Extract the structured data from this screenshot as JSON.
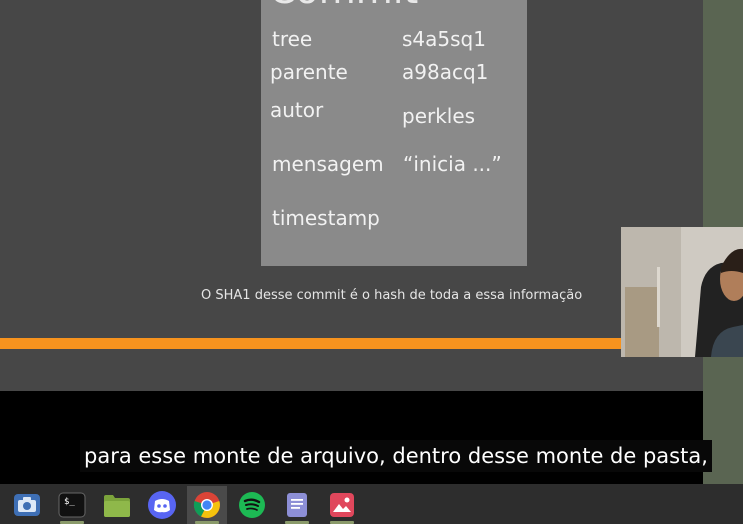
{
  "slide": {
    "commit_title": "Commit",
    "fields": [
      {
        "key": "tree",
        "value": "s4a5sq1"
      },
      {
        "key": "parente",
        "value": "a98acq1"
      },
      {
        "key": "autor",
        "value": "perkles"
      },
      {
        "key": "mensagem",
        "value": "“inicia ...”"
      },
      {
        "key": "timestamp",
        "value": ""
      }
    ],
    "caption": "O SHA1 desse commit é o hash de toda a essa informação"
  },
  "subtitle": {
    "text": "para esse monte de arquivo, dentro desse monte de pasta,"
  },
  "taskbar": {
    "items": [
      {
        "icon": "screenshot-icon"
      },
      {
        "icon": "terminal-icon"
      },
      {
        "icon": "files-icon"
      },
      {
        "icon": "discord-icon"
      },
      {
        "icon": "chrome-icon"
      },
      {
        "icon": "spotify-icon"
      },
      {
        "icon": "text-editor-icon"
      },
      {
        "icon": "image-viewer-icon"
      }
    ]
  },
  "colors": {
    "accent_orange": "#f7931e",
    "commit_box": "#8a8a8a",
    "slide_bg": "#474747"
  }
}
